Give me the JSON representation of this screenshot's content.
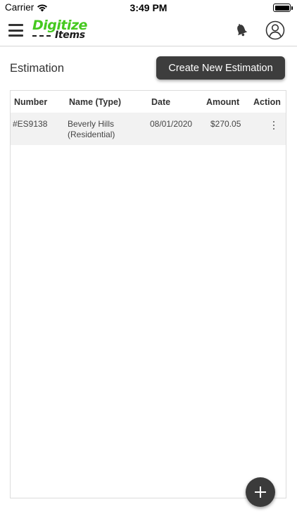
{
  "status_bar": {
    "carrier": "Carrier",
    "time": "3:49 PM"
  },
  "header": {
    "logo_line1": "Digitize",
    "logo_line2": "Items",
    "icons": [
      "hamburger-menu-icon",
      "bell-icon",
      "user-profile-icon"
    ],
    "logo_colors": {
      "primary": "#45c91f",
      "secondary": "#1a1a1a"
    }
  },
  "page": {
    "title": "Estimation",
    "create_button_label": "Create New Estimation"
  },
  "table": {
    "columns": [
      "Number",
      "Name (Type)",
      "Date",
      "Amount",
      "Action"
    ],
    "rows": [
      {
        "number": "#ES9138",
        "name_line1": "Beverly Hills",
        "name_line2": "(Residential)",
        "date": "08/01/2020",
        "amount": "$270.05",
        "action_icon": "more-vertical-icon"
      }
    ]
  },
  "fab": {
    "icon": "plus-icon"
  },
  "colors": {
    "button_bg": "#3d3d3d",
    "row_bg": "#f2f2f2",
    "border": "#dcdcdc"
  }
}
